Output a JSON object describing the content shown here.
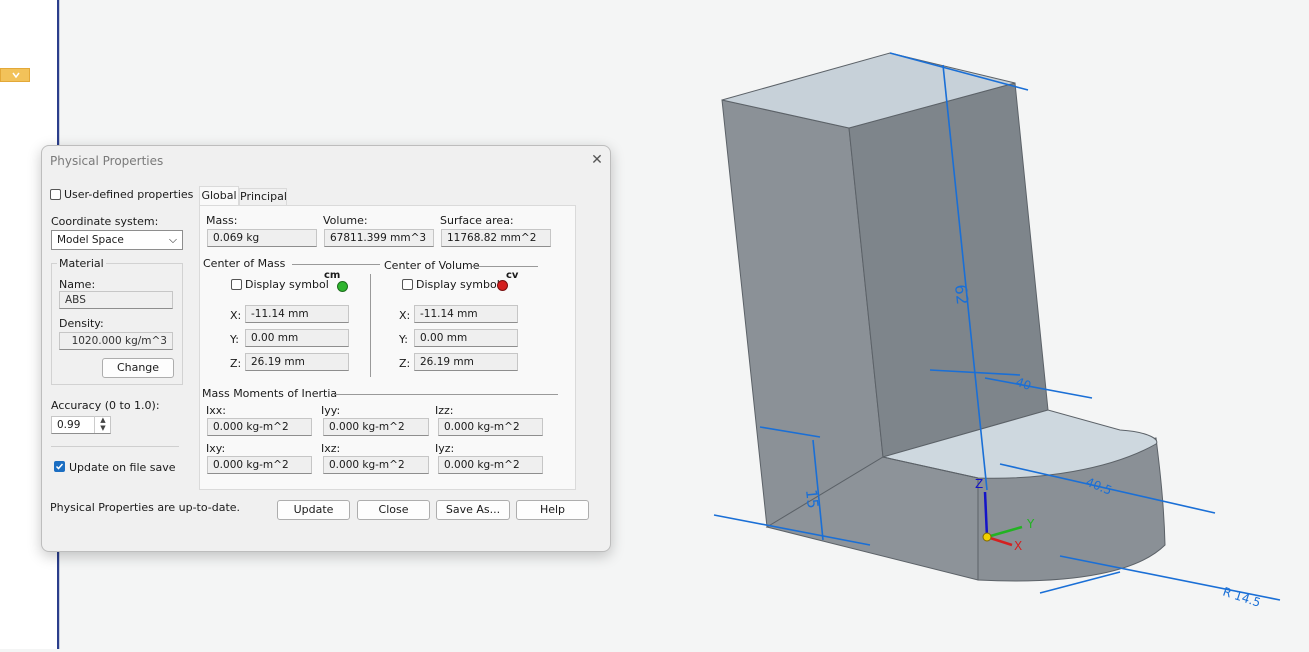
{
  "dialog": {
    "title": "Physical Properties",
    "user_defined_label": "User-defined properties",
    "coordinate_system_label": "Coordinate system:",
    "coordinate_system_value": "Model Space",
    "material": {
      "group_label": "Material",
      "name_label": "Name:",
      "name_value": "ABS",
      "density_label": "Density:",
      "density_value": "1020.000 kg/m^3",
      "change_label": "Change"
    },
    "accuracy_label": "Accuracy (0 to 1.0):",
    "accuracy_value": "0.99",
    "update_on_save_label": "Update on file save",
    "update_on_save_checked": true,
    "tabs": [
      "Global",
      "Principal"
    ],
    "mass_label": "Mass:",
    "mass_value": "0.069 kg",
    "volume_label": "Volume:",
    "volume_value": "67811.399 mm^3",
    "surface_label": "Surface area:",
    "surface_value": "11768.82 mm^2",
    "center_mass": {
      "label": "Center of Mass",
      "display_symbol": "Display symbol",
      "symbol_text": "cm",
      "symbol_color": "#2fb52f",
      "x_label": "X:",
      "x_value": "-11.14 mm",
      "y_label": "Y:",
      "y_value": "0.00 mm",
      "z_label": "Z:",
      "z_value": "26.19 mm"
    },
    "center_volume": {
      "label": "Center of Volume",
      "display_symbol": "Display symbol",
      "symbol_text": "cv",
      "symbol_color": "#d42020",
      "x_label": "X:",
      "x_value": "-11.14 mm",
      "y_label": "Y:",
      "y_value": "0.00 mm",
      "z_label": "Z:",
      "z_value": "26.19 mm"
    },
    "inertia": {
      "label": "Mass Moments of Inertia",
      "ixx_label": "Ixx:",
      "ixx_value": "0.000 kg-m^2",
      "iyy_label": "Iyy:",
      "iyy_value": "0.000 kg-m^2",
      "izz_label": "Izz:",
      "izz_value": "0.000 kg-m^2",
      "ixy_label": "Ixy:",
      "ixy_value": "0.000 kg-m^2",
      "ixz_label": "Ixz:",
      "ixz_value": "0.000 kg-m^2",
      "iyz_label": "Iyz:",
      "iyz_value": "0.000 kg-m^2"
    },
    "status": "Physical Properties are up-to-date.",
    "buttons": {
      "update": "Update",
      "close": "Close",
      "save_as": "Save As...",
      "help": "Help"
    }
  },
  "viewport": {
    "dimensions": {
      "height": "62",
      "small": "40",
      "base": "15",
      "width": "40.5",
      "radius": "R 14.5"
    },
    "axes": {
      "x": "X",
      "y": "Y",
      "z": "Z"
    },
    "colors": {
      "dimension": "#1a6fd6",
      "body": "#8a9096",
      "top_face": "#c9d3db"
    }
  }
}
